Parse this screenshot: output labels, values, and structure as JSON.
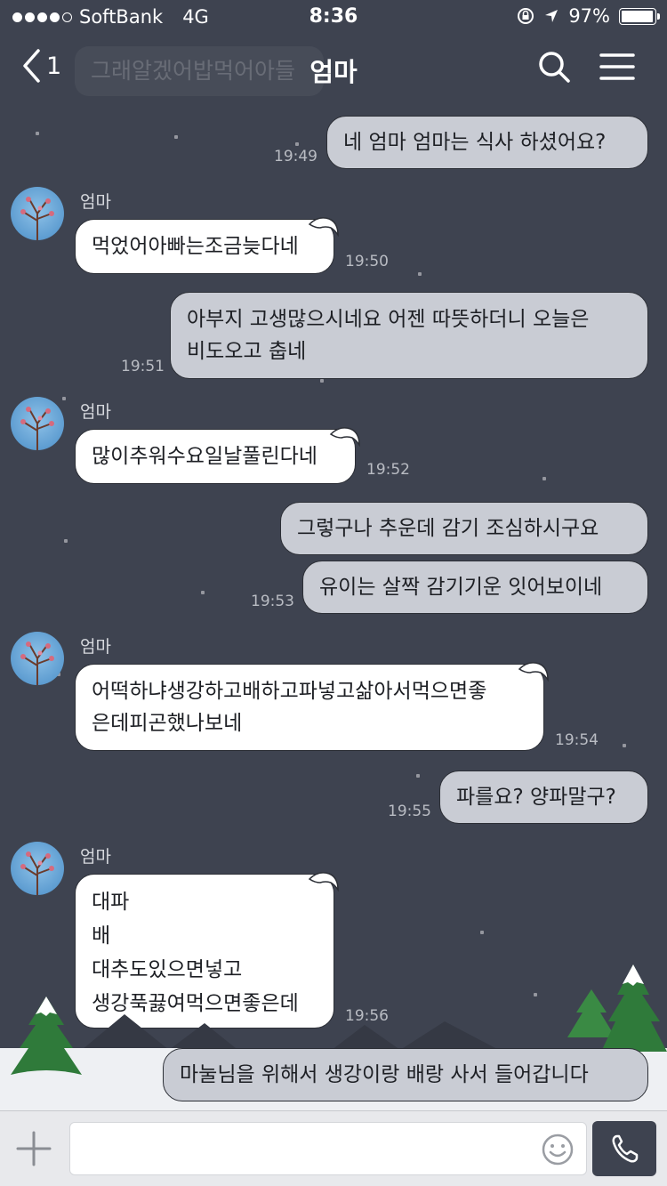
{
  "status_bar": {
    "carrier": "SoftBank",
    "network": "4G",
    "time": "8:36",
    "battery": "97%",
    "battery_level": 0.97
  },
  "header": {
    "back_count": "1",
    "preview_text": "그래알겠어밥먹어아들",
    "title": "엄마"
  },
  "messages": {
    "m1": {
      "text": "네 엄마 엄마는 식사 하셨어요?",
      "time": "19:49"
    },
    "m2": {
      "sender": "엄마",
      "text": "먹었어아빠는조금늦다네",
      "time": "19:50"
    },
    "m3": {
      "text": "아부지 고생많으시네요 어젠 따뜻하더니 오늘은\n비도오고 춥네",
      "time": "19:51"
    },
    "m4": {
      "sender": "엄마",
      "text": "많이추워수요일날풀린다네",
      "time": "19:52"
    },
    "m5": {
      "text": "그렇구나 추운데 감기 조심하시구요"
    },
    "m6": {
      "text": "유이는 살짝 감기기운 잇어보이네",
      "time": "19:53"
    },
    "m7": {
      "sender": "엄마",
      "text": "어떡하냐생강하고배하고파넣고삶아서먹으면좋\n은데피곤했나보네",
      "time": "19:54"
    },
    "m8": {
      "text": "파를요? 양파말구?",
      "time": "19:55"
    },
    "m9": {
      "sender": "엄마",
      "text": "대파\n배\n대추도있으면넣고\n생강푹끓여먹으면좋은데",
      "time": "19:56"
    },
    "m10": {
      "text": "마눌님을 위해서 생강이랑 배랑 사서 들어갑니다"
    }
  },
  "input": {
    "placeholder": ""
  },
  "icons": {
    "back": "chevron-left-icon",
    "search": "search-icon",
    "menu": "hamburger-menu-icon",
    "add": "plus-icon",
    "emoji": "smiley-icon",
    "call": "phone-icon"
  },
  "colors": {
    "background": "#3e4350",
    "outgoing_bubble": "#c9ccd4",
    "incoming_bubble": "#ffffff",
    "timestamp": "#b9bcc3"
  }
}
